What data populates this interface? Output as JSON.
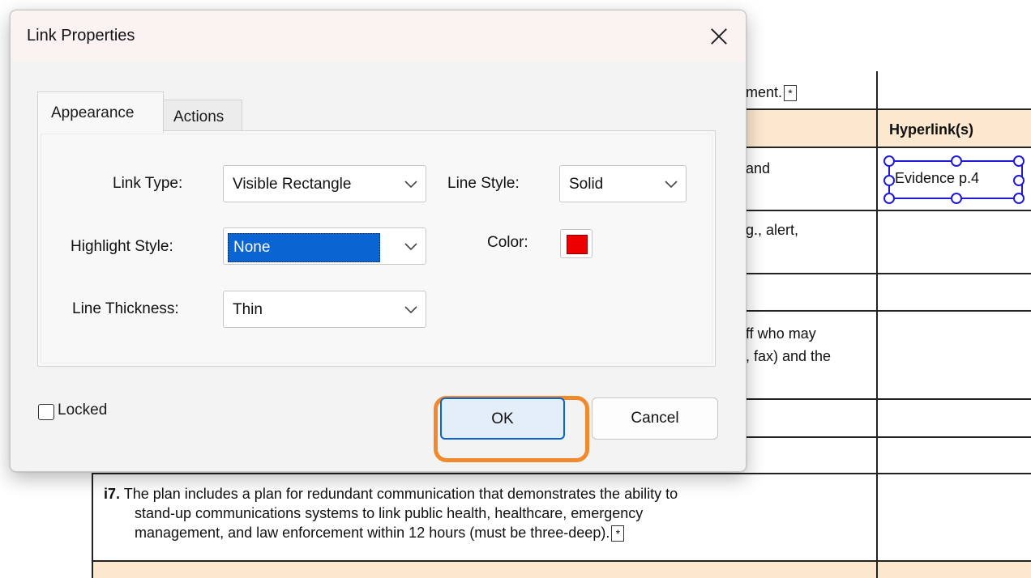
{
  "dialog": {
    "title": "Link Properties",
    "tabs": {
      "appearance": "Appearance",
      "actions": "Actions"
    },
    "link_type": {
      "label": "Link Type:",
      "value": "Visible Rectangle"
    },
    "line_style": {
      "label": "Line Style:",
      "value": "Solid"
    },
    "highlight_style": {
      "label": "Highlight Style:",
      "value": "None"
    },
    "color": {
      "label": "Color:",
      "value": "#ee0000"
    },
    "line_thickness": {
      "label": "Line Thickness:",
      "value": "Thin"
    },
    "locked_label": "Locked",
    "ok_label": "OK",
    "cancel_label": "Cancel"
  },
  "document": {
    "row1_text": "ment.",
    "header_col": "Hyperlink(s)",
    "row2_text": "and",
    "link_label": "Evidence p.4",
    "row3_text": "g., alert,",
    "row4_line1": "ff who may",
    "row4_line2": ", fax) and the",
    "i7_number": "i7.",
    "i7_line1": "The plan includes a plan for redundant communication that demonstrates the ability to",
    "i7_line2": "stand-up communications systems to link public health, healthcare, emergency",
    "i7_line3": "management, and law enforcement within 12 hours (must be three-deep).",
    "marker_glyph": "*"
  },
  "colors": {
    "accent": "#0b63d2",
    "highlight_ring": "#f08a2c",
    "header_band": "#fce8cf",
    "link_border": "#1e1ad6"
  }
}
